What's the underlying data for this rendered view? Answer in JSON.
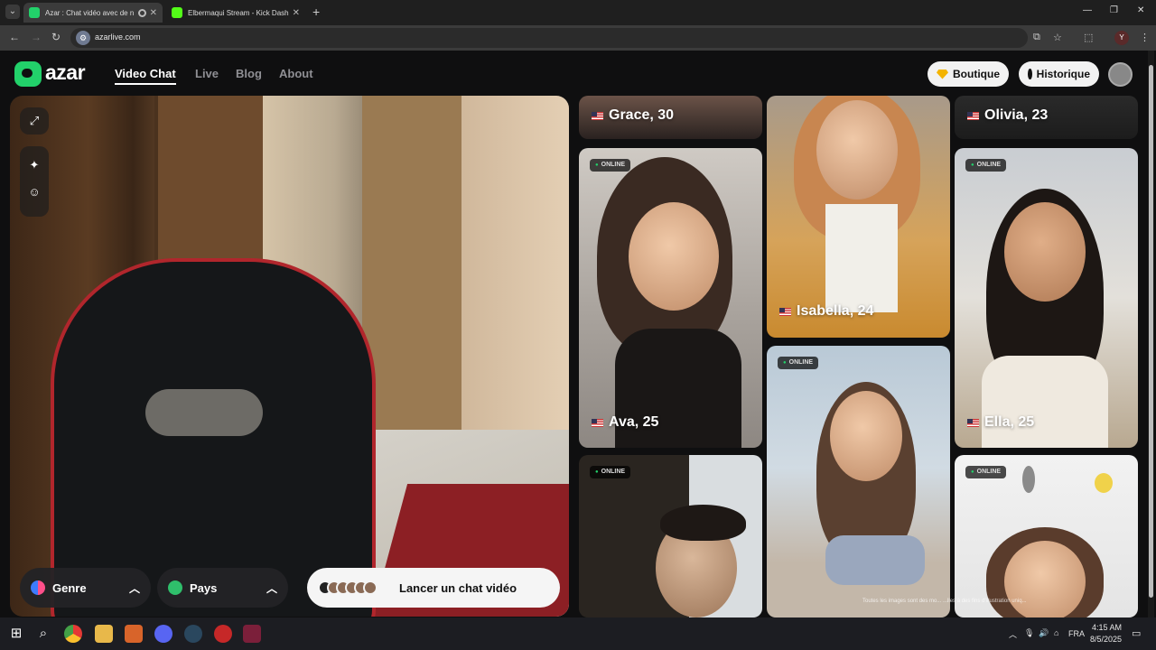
{
  "browser": {
    "tabs": [
      {
        "title": "Azar : Chat vidéo avec de n",
        "active": true
      },
      {
        "title": "Elbermaqui Stream - Kick Dash",
        "active": false
      }
    ],
    "new_tab": "+",
    "url": "azarlive.com",
    "profile_initial": "Y",
    "window_controls": [
      "—",
      "❐",
      "✕"
    ]
  },
  "site": {
    "logo_text": "azar",
    "nav": [
      "Video Chat",
      "Live",
      "Blog",
      "About"
    ],
    "boutique_label": "Boutique",
    "historique_label": "Historique"
  },
  "controls": {
    "genre_label": "Genre",
    "pays_label": "Pays",
    "launch_label": "Lancer un chat vidéo"
  },
  "cards": {
    "online_label": "ONLINE",
    "grace": "Grace, 30",
    "olivia": "Olivia, 23",
    "isabella": "Isabella, 24",
    "ava": "Ava, 25",
    "ella": "Ella, 25"
  },
  "disclaimer": "Toutes les images sont des mo... ...lles à des fins d'illustration uniq...",
  "taskbar": {
    "language": "FRA",
    "time": "4:15 AM",
    "date": "8/5/2025"
  },
  "colors": {
    "accent": "#22d16a",
    "background": "#0f0f10"
  }
}
